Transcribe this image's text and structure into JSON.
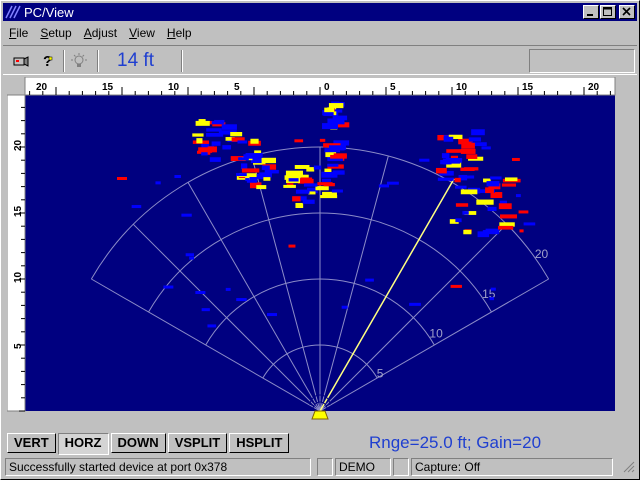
{
  "window": {
    "title": "PC/View"
  },
  "menu": [
    {
      "label": "File",
      "ul": "F",
      "rest": "ile"
    },
    {
      "label": "Setup",
      "ul": "S",
      "rest": "etup"
    },
    {
      "label": "Adjust",
      "ul": "A",
      "rest": "djust"
    },
    {
      "label": "View",
      "ul": "V",
      "rest": "iew"
    },
    {
      "label": "Help",
      "ul": "H",
      "rest": "elp"
    }
  ],
  "toolbar": {
    "icons": [
      "camera-icon",
      "help-question-icon",
      "light-bulb-icon"
    ],
    "range_display": "14 ft"
  },
  "sonar": {
    "top_ruler": [
      "20",
      "15",
      "10",
      "5",
      "0",
      "5",
      "10",
      "15",
      "20"
    ],
    "left_ruler": [
      "20",
      "15",
      "10",
      "5"
    ],
    "range_ring_labels": [
      "5",
      "10",
      "15",
      "20"
    ],
    "colors": {
      "background": "#000080",
      "grid": "#8c8cc8",
      "return_strong": "#ff0000",
      "return_medium": "#ffff00",
      "return_weak": "#0000ff",
      "sweep_line": "#ffff80"
    }
  },
  "tabs": [
    {
      "label": "VERT",
      "active": false
    },
    {
      "label": "HORZ",
      "active": true
    },
    {
      "label": "DOWN",
      "active": false
    },
    {
      "label": "VSPLIT",
      "active": false
    },
    {
      "label": "HSPLIT",
      "active": false
    }
  ],
  "readout": "Rnge=25.0 ft; Gain=20",
  "status": {
    "message": "Successfully started device at port 0x378",
    "mode": "DEMO",
    "capture": "Capture: Off"
  }
}
